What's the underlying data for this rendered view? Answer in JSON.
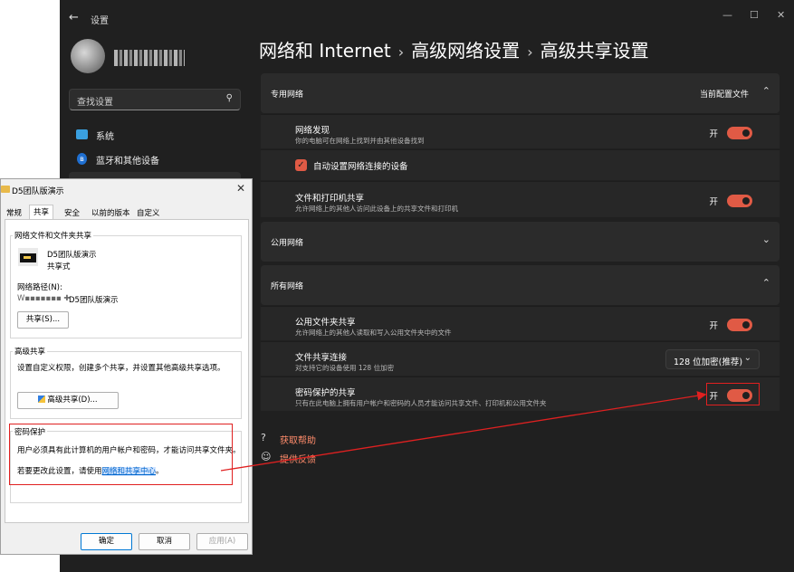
{
  "settings": {
    "app_title": "设置",
    "search_placeholder": "查找设置",
    "nav": [
      {
        "label": "系统",
        "icon": "monitor-icon"
      },
      {
        "label": "蓝牙和其他设备",
        "icon": "bluetooth-icon"
      }
    ],
    "breadcrumb": [
      "网络和 Internet",
      "高级网络设置",
      "高级共享设置"
    ],
    "private_network": {
      "header": "专用网络",
      "profile_label": "当前配置文件",
      "discovery_title": "网络发现",
      "discovery_sub": "你的电脑可在网络上找到并由其他设备找到",
      "auto_setup_label": "自动设置网络连接的设备",
      "file_printer_title": "文件和打印机共享",
      "file_printer_sub": "允许网络上的其他人访问此设备上的共享文件和打印机"
    },
    "public_network": {
      "header": "公用网络"
    },
    "all_networks": {
      "header": "所有网络",
      "public_folder_title": "公用文件夹共享",
      "public_folder_sub": "允许网络上的其他人读取和写入公用文件夹中的文件",
      "file_sharing_title": "文件共享连接",
      "file_sharing_sub": "对支持它的设备使用 128 位加密",
      "encryption_value": "128 位加密(推荐)",
      "password_title": "密码保护的共享",
      "password_sub": "只有在此电脑上拥有用户帐户和密码的人员才能访问共享文件、打印机和公用文件夹"
    },
    "toggle_on_label": "开",
    "help_link": "获取帮助",
    "feedback_link": "提供反馈",
    "accent_color": "#e05a45"
  },
  "dialog": {
    "title": "D5团队版演示",
    "tabs": [
      "常规",
      "共享",
      "安全",
      "以前的版本",
      "自定义"
    ],
    "active_tab": "共享",
    "share_group_title": "网络文件和文件夹共享",
    "folder_name": "D5团队版演示",
    "share_state": "共享式",
    "network_path_label": "网络路径(N):",
    "network_path_value": "D5团队版演示",
    "share_button": "共享(S)...",
    "advanced_group_title": "高级共享",
    "advanced_desc": "设置自定义权限，创建多个共享，并设置其他高级共享选项。",
    "advanced_button": "高级共享(D)...",
    "password_group_title": "密码保护",
    "password_desc": "用户必须具有此计算机的用户帐户和密码，才能访问共享文件夹。",
    "change_prefix": "若要更改此设置，请使用",
    "change_link": "网络和共享中心",
    "change_suffix": "。",
    "ok": "确定",
    "cancel": "取消",
    "apply": "应用(A)"
  }
}
